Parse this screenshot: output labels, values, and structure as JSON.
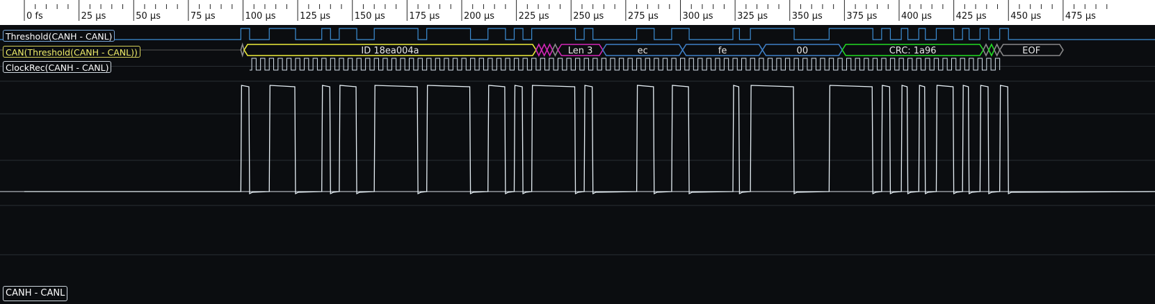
{
  "time_axis": {
    "tick_labels": [
      "0 fs",
      "25 µs",
      "50 µs",
      "75 µs",
      "100 µs",
      "125 µs",
      "150 µs",
      "175 µs",
      "200 µs",
      "225 µs",
      "250 µs",
      "275 µs",
      "300 µs",
      "325 µs",
      "350 µs",
      "375 µs",
      "400 µs",
      "425 µs",
      "450 µs",
      "475 µs"
    ]
  },
  "channels": {
    "threshold": {
      "label": "Threshold(CANH - CANL)",
      "color": "#3d8fd6"
    },
    "can": {
      "label": "CAN(Threshold(CANH - CANL))",
      "color": "#f0ee3a"
    },
    "clock": {
      "label": "ClockRec(CANH - CANL)",
      "color": "#d8e4ee"
    },
    "analog": {
      "label": "CANH - CANL",
      "color": "#e8f1f7"
    }
  },
  "can_fields": [
    {
      "text": "",
      "color": "#8a8a8a",
      "t0": 99,
      "t1": 100.5
    },
    {
      "text": "ID 18ea004a",
      "color": "#f0ee3a",
      "t0": 100.5,
      "t1": 234
    },
    {
      "text": "",
      "color": "#d426b8",
      "t0": 234,
      "t1": 236.5
    },
    {
      "text": "",
      "color": "#d426b8",
      "t0": 236.5,
      "t1": 239
    },
    {
      "text": "",
      "color": "#d426b8",
      "t0": 239,
      "t1": 241.5
    },
    {
      "text": "",
      "color": "#8a8a8a",
      "t0": 241.5,
      "t1": 244
    },
    {
      "text": "Len 3",
      "color": "#d426b8",
      "t0": 244,
      "t1": 264.5
    },
    {
      "text": "ec",
      "color": "#3f80c8",
      "t0": 264.5,
      "t1": 301
    },
    {
      "text": "fe",
      "color": "#3f80c8",
      "t0": 301,
      "t1": 337.5
    },
    {
      "text": "00",
      "color": "#3f80c8",
      "t0": 337.5,
      "t1": 374
    },
    {
      "text": "CRC: 1a96",
      "color": "#22dd22",
      "t0": 374,
      "t1": 438.5
    },
    {
      "text": "",
      "color": "#8a8a8a",
      "t0": 438.5,
      "t1": 441
    },
    {
      "text": "",
      "color": "#22dd22",
      "t0": 441,
      "t1": 443.5
    },
    {
      "text": "",
      "color": "#8a8a8a",
      "t0": 443.5,
      "t1": 446
    },
    {
      "text": "EOF",
      "color": "#8a8a8a",
      "t0": 446,
      "t1": 475
    }
  ],
  "signal": {
    "high_intervals_us": [
      [
        99,
        103
      ],
      [
        112,
        124
      ],
      [
        136,
        140
      ],
      [
        144,
        152
      ],
      [
        160,
        180
      ],
      [
        184,
        204
      ],
      [
        212,
        220
      ],
      [
        224,
        228
      ],
      [
        232,
        252
      ],
      [
        256,
        260
      ],
      [
        280,
        288
      ],
      [
        296,
        304
      ],
      [
        324,
        327
      ],
      [
        332,
        352
      ],
      [
        368,
        388
      ],
      [
        392,
        396
      ],
      [
        401,
        404
      ],
      [
        409,
        412
      ],
      [
        417,
        425
      ],
      [
        429,
        432
      ],
      [
        437,
        441
      ],
      [
        446,
        450
      ]
    ],
    "clock_start_us": 104,
    "clock_end_us": 446,
    "clock_period_us": 4
  }
}
